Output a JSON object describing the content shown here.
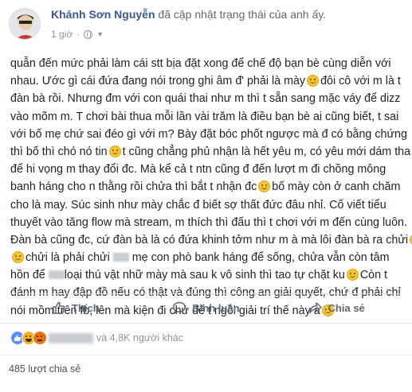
{
  "post": {
    "author": "Khánh Sơn Nguyễn",
    "action": "đã cập nhật trạng thái của anh ấy.",
    "time": "1 giờ",
    "privacy_icon": "globe-icon",
    "lines": [
      "quẫn đến mức phải làm cái stt bịa đặt xong để chế độ bạn bè cùng diễn với",
      "nhau. Ước gì cái đứa đang nói trong ghi âm đ' phải là mày",
      "đàn bà rồi. Nhưng đm với con quái thai như m thì t sẵn sang mặc váy để dizz",
      "vào mõm m. T chơi bài thua mỗi lần vài trăm là điều bạn bè ai cũng biết, t sai",
      "với bố mẹ chứ sai đéo gì với m? Bày đặt bóc phốt ngược mà đ có bằng chứng",
      "thì bố thì chó nó tin",
      "để hi vọng m thay đổi đc. Mà kể cả t ntn cũng đ đến lượt m đi chồng mông",
      "banh háng cho n thằng rồi chửa thì bắt t nhận đc",
      "cho là may. Súc sinh như mày chắc đ biết sợ thất đức đâu nhỉ. Cố viết tiểu",
      "thuyết vào tăng flow mà stream, m thích thì đấu thì t chơi với m đến cùng luôn.",
      "Đàn bà cũng đc, cứ đàn bà là có đứa khinh tởm như m à mà lôi đàn bà ra chửi",
      "chửi là phải chửi",
      "hồn để",
      "đánh m hay đập đồ nếu có thật và đúng thì công an giải quyết, chứ đ phải chỉ",
      "nói mồm trên fb, lên mà kiện đi chứ để t ngồi giải trí thế này à"
    ],
    "fragments": {
      "l2_end": "đôi cô với m là t",
      "l6_end": "t cũng chẳng phủ nhận là hết yêu m, có yêu mới dám tha thứ",
      "l8_end": "bố mày còn ở canh chăm",
      "l12_end": "mẹ con phò bank háng để sống, chửa vẫn còn tâm",
      "l13_end": "loại thú vật nhữ mày mà sau k vô sinh thì tao tự chặt ku",
      "l13_tail": "Còn t"
    }
  },
  "actions": {
    "like": "Thích",
    "comment": "Bình luận",
    "share": "Chia sẻ"
  },
  "reactions": {
    "types": [
      "like",
      "haha",
      "angry"
    ],
    "summary": "và 4,8K người khác"
  },
  "shares": "485 lượt chia sẻ"
}
